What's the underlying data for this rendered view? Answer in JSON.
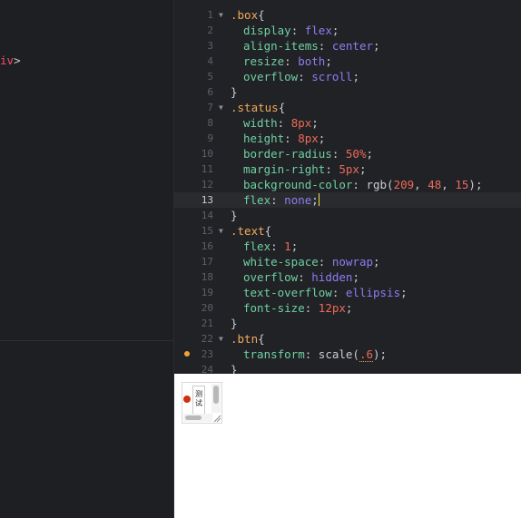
{
  "left_editor": {
    "visible_fragment_tag": "iv",
    "visible_fragment_close": ">"
  },
  "css_editor": {
    "active_line": 13,
    "lines": [
      {
        "n": "1",
        "tokens": [
          {
            "c": "sel",
            "t": ".box"
          },
          {
            "c": "brace",
            "t": "{"
          }
        ],
        "fold": true,
        "indent": 0
      },
      {
        "n": "2",
        "tokens": [
          {
            "c": "prop",
            "t": "display"
          },
          {
            "c": "colon",
            "t": ": "
          },
          {
            "c": "kw",
            "t": "flex"
          },
          {
            "c": "semi",
            "t": ";"
          }
        ],
        "indent": 1
      },
      {
        "n": "3",
        "tokens": [
          {
            "c": "prop",
            "t": "align-items"
          },
          {
            "c": "colon",
            "t": ": "
          },
          {
            "c": "kw",
            "t": "center"
          },
          {
            "c": "semi",
            "t": ";"
          }
        ],
        "indent": 1
      },
      {
        "n": "4",
        "tokens": [
          {
            "c": "prop",
            "t": "resize"
          },
          {
            "c": "colon",
            "t": ": "
          },
          {
            "c": "kw",
            "t": "both"
          },
          {
            "c": "semi",
            "t": ";"
          }
        ],
        "indent": 1
      },
      {
        "n": "5",
        "tokens": [
          {
            "c": "prop",
            "t": "overflow"
          },
          {
            "c": "colon",
            "t": ": "
          },
          {
            "c": "kw",
            "t": "scroll"
          },
          {
            "c": "semi",
            "t": ";"
          }
        ],
        "indent": 1
      },
      {
        "n": "6",
        "tokens": [
          {
            "c": "brace",
            "t": "}"
          }
        ],
        "indent": 0
      },
      {
        "n": "7",
        "tokens": [
          {
            "c": "sel",
            "t": ".status"
          },
          {
            "c": "brace",
            "t": "{"
          }
        ],
        "fold": true,
        "indent": 0
      },
      {
        "n": "8",
        "tokens": [
          {
            "c": "prop",
            "t": "width"
          },
          {
            "c": "colon",
            "t": ": "
          },
          {
            "c": "num",
            "t": "8px"
          },
          {
            "c": "semi",
            "t": ";"
          }
        ],
        "indent": 1
      },
      {
        "n": "9",
        "tokens": [
          {
            "c": "prop",
            "t": "height"
          },
          {
            "c": "colon",
            "t": ": "
          },
          {
            "c": "num",
            "t": "8px"
          },
          {
            "c": "semi",
            "t": ";"
          }
        ],
        "indent": 1
      },
      {
        "n": "10",
        "tokens": [
          {
            "c": "prop",
            "t": "border-radius"
          },
          {
            "c": "colon",
            "t": ": "
          },
          {
            "c": "num",
            "t": "50%"
          },
          {
            "c": "semi",
            "t": ";"
          }
        ],
        "indent": 1
      },
      {
        "n": "11",
        "tokens": [
          {
            "c": "prop",
            "t": "margin-right"
          },
          {
            "c": "colon",
            "t": ": "
          },
          {
            "c": "num",
            "t": "5px"
          },
          {
            "c": "semi",
            "t": ";"
          }
        ],
        "indent": 1
      },
      {
        "n": "12",
        "tokens": [
          {
            "c": "prop",
            "t": "background-color"
          },
          {
            "c": "colon",
            "t": ": "
          },
          {
            "c": "fn",
            "t": "rgb("
          },
          {
            "c": "num",
            "t": "209"
          },
          {
            "c": "fn",
            "t": ", "
          },
          {
            "c": "num",
            "t": "48"
          },
          {
            "c": "fn",
            "t": ", "
          },
          {
            "c": "num",
            "t": "15"
          },
          {
            "c": "fn",
            "t": ")"
          },
          {
            "c": "semi",
            "t": ";"
          }
        ],
        "indent": 1
      },
      {
        "n": "13",
        "tokens": [
          {
            "c": "prop",
            "t": "flex"
          },
          {
            "c": "colon",
            "t": ": "
          },
          {
            "c": "kw",
            "t": "none"
          },
          {
            "c": "semi",
            "t": ";"
          }
        ],
        "indent": 1,
        "cursor": true
      },
      {
        "n": "14",
        "tokens": [
          {
            "c": "brace",
            "t": "}"
          }
        ],
        "indent": 0
      },
      {
        "n": "15",
        "tokens": [
          {
            "c": "sel",
            "t": ".text"
          },
          {
            "c": "brace",
            "t": "{"
          }
        ],
        "fold": true,
        "indent": 0
      },
      {
        "n": "16",
        "tokens": [
          {
            "c": "prop",
            "t": "flex"
          },
          {
            "c": "colon",
            "t": ": "
          },
          {
            "c": "num",
            "t": "1"
          },
          {
            "c": "semi",
            "t": ";"
          }
        ],
        "indent": 1
      },
      {
        "n": "17",
        "tokens": [
          {
            "c": "prop",
            "t": "white-space"
          },
          {
            "c": "colon",
            "t": ": "
          },
          {
            "c": "kw",
            "t": "nowrap"
          },
          {
            "c": "semi",
            "t": ";"
          }
        ],
        "indent": 1
      },
      {
        "n": "18",
        "tokens": [
          {
            "c": "prop",
            "t": "overflow"
          },
          {
            "c": "colon",
            "t": ": "
          },
          {
            "c": "kw",
            "t": "hidden"
          },
          {
            "c": "semi",
            "t": ";"
          }
        ],
        "indent": 1
      },
      {
        "n": "19",
        "tokens": [
          {
            "c": "prop",
            "t": "text-overflow"
          },
          {
            "c": "colon",
            "t": ": "
          },
          {
            "c": "kw",
            "t": "ellipsis"
          },
          {
            "c": "semi",
            "t": ";"
          }
        ],
        "indent": 1
      },
      {
        "n": "20",
        "tokens": [
          {
            "c": "prop",
            "t": "font-size"
          },
          {
            "c": "colon",
            "t": ": "
          },
          {
            "c": "num",
            "t": "12px"
          },
          {
            "c": "semi",
            "t": ";"
          }
        ],
        "indent": 1
      },
      {
        "n": "21",
        "tokens": [
          {
            "c": "brace",
            "t": "}"
          }
        ],
        "indent": 0
      },
      {
        "n": "22",
        "tokens": [
          {
            "c": "sel",
            "t": ".btn"
          },
          {
            "c": "brace",
            "t": "{"
          }
        ],
        "fold": true,
        "indent": 0
      },
      {
        "n": "23",
        "tokens": [
          {
            "c": "prop",
            "t": "transform"
          },
          {
            "c": "colon",
            "t": ": "
          },
          {
            "c": "fn",
            "t": "scale("
          },
          {
            "c": "num",
            "t": ".6",
            "warn": true
          },
          {
            "c": "fn",
            "t": ")"
          },
          {
            "c": "semi",
            "t": ";"
          }
        ],
        "indent": 1,
        "warning": true
      },
      {
        "n": "24",
        "tokens": [
          {
            "c": "brace",
            "t": "}"
          }
        ],
        "indent": 0
      }
    ]
  },
  "preview": {
    "text_content": "测试",
    "status_color": "#d1300f"
  },
  "colors": {
    "selector": "#f2a95a",
    "property": "#6fd0a2",
    "keyword": "#8f7cf3",
    "number": "#ee6a58",
    "warning": "#f1a13a",
    "cursor": "#f5d94a"
  }
}
